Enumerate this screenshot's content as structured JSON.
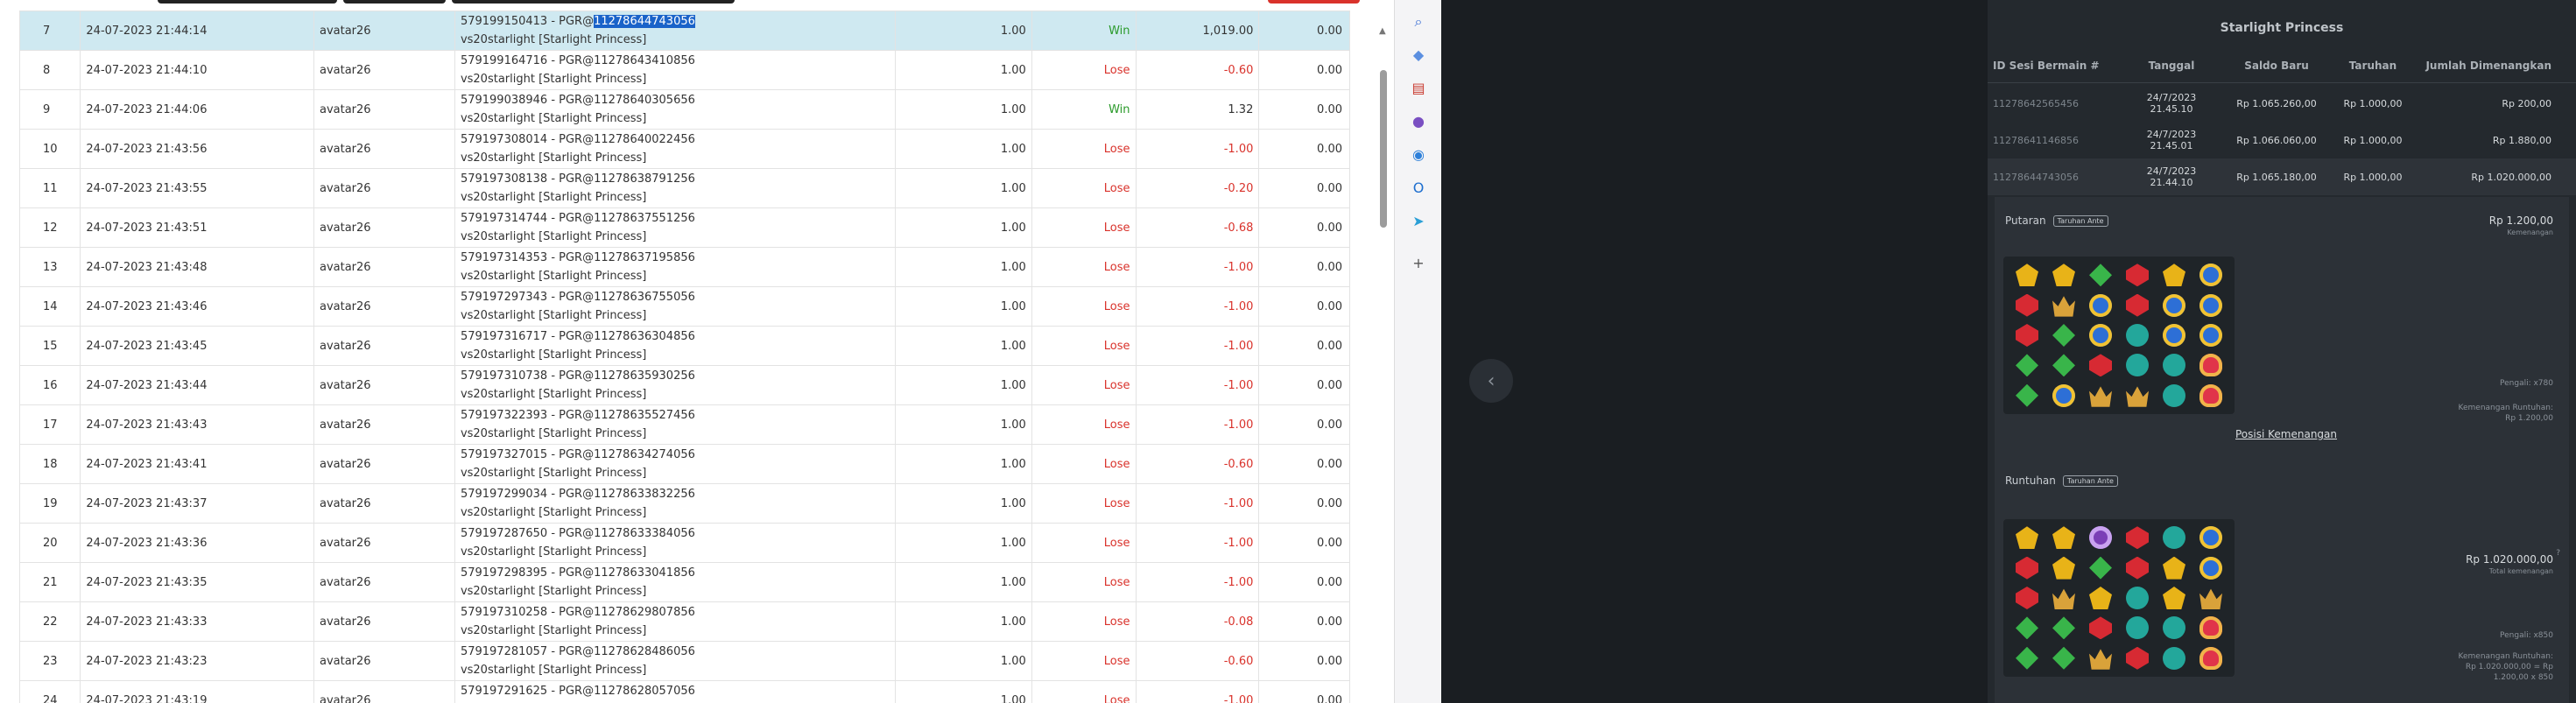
{
  "table": {
    "rows": [
      {
        "no": "7",
        "date": "24-07-2023 21:44:14",
        "user": "avatar26",
        "desc_prefix": "579199150413 - PGR@",
        "desc_selected": "11278644743056",
        "desc_line2": "vs20starlight [Starlight Princess]",
        "bet": "1.00",
        "result": "Win",
        "win": "1,019.00",
        "balance": "0.00"
      },
      {
        "no": "8",
        "date": "24-07-2023 21:44:10",
        "user": "avatar26",
        "desc_prefix": "579199164716 - PGR@11278643410856",
        "desc_selected": "",
        "desc_line2": "vs20starlight [Starlight Princess]",
        "bet": "1.00",
        "result": "Lose",
        "win": "-0.60",
        "balance": "0.00"
      },
      {
        "no": "9",
        "date": "24-07-2023 21:44:06",
        "user": "avatar26",
        "desc_prefix": "579199038946 - PGR@11278640305656",
        "desc_selected": "",
        "desc_line2": "vs20starlight [Starlight Princess]",
        "bet": "1.00",
        "result": "Win",
        "win": "1.32",
        "balance": "0.00"
      },
      {
        "no": "10",
        "date": "24-07-2023 21:43:56",
        "user": "avatar26",
        "desc_prefix": "579197308014 - PGR@11278640022456",
        "desc_selected": "",
        "desc_line2": "vs20starlight [Starlight Princess]",
        "bet": "1.00",
        "result": "Lose",
        "win": "-1.00",
        "balance": "0.00"
      },
      {
        "no": "11",
        "date": "24-07-2023 21:43:55",
        "user": "avatar26",
        "desc_prefix": "579197308138 - PGR@11278638791256",
        "desc_selected": "",
        "desc_line2": "vs20starlight [Starlight Princess]",
        "bet": "1.00",
        "result": "Lose",
        "win": "-0.20",
        "balance": "0.00"
      },
      {
        "no": "12",
        "date": "24-07-2023 21:43:51",
        "user": "avatar26",
        "desc_prefix": "579197314744 - PGR@11278637551256",
        "desc_selected": "",
        "desc_line2": "vs20starlight [Starlight Princess]",
        "bet": "1.00",
        "result": "Lose",
        "win": "-0.68",
        "balance": "0.00"
      },
      {
        "no": "13",
        "date": "24-07-2023 21:43:48",
        "user": "avatar26",
        "desc_prefix": "579197314353 - PGR@11278637195856",
        "desc_selected": "",
        "desc_line2": "vs20starlight [Starlight Princess]",
        "bet": "1.00",
        "result": "Lose",
        "win": "-1.00",
        "balance": "0.00"
      },
      {
        "no": "14",
        "date": "24-07-2023 21:43:46",
        "user": "avatar26",
        "desc_prefix": "579197297343 - PGR@11278636755056",
        "desc_selected": "",
        "desc_line2": "vs20starlight [Starlight Princess]",
        "bet": "1.00",
        "result": "Lose",
        "win": "-1.00",
        "balance": "0.00"
      },
      {
        "no": "15",
        "date": "24-07-2023 21:43:45",
        "user": "avatar26",
        "desc_prefix": "579197316717 - PGR@11278636304856",
        "desc_selected": "",
        "desc_line2": "vs20starlight [Starlight Princess]",
        "bet": "1.00",
        "result": "Lose",
        "win": "-1.00",
        "balance": "0.00"
      },
      {
        "no": "16",
        "date": "24-07-2023 21:43:44",
        "user": "avatar26",
        "desc_prefix": "579197310738 - PGR@11278635930256",
        "desc_selected": "",
        "desc_line2": "vs20starlight [Starlight Princess]",
        "bet": "1.00",
        "result": "Lose",
        "win": "-1.00",
        "balance": "0.00"
      },
      {
        "no": "17",
        "date": "24-07-2023 21:43:43",
        "user": "avatar26",
        "desc_prefix": "579197322393 - PGR@11278635527456",
        "desc_selected": "",
        "desc_line2": "vs20starlight [Starlight Princess]",
        "bet": "1.00",
        "result": "Lose",
        "win": "-1.00",
        "balance": "0.00"
      },
      {
        "no": "18",
        "date": "24-07-2023 21:43:41",
        "user": "avatar26",
        "desc_prefix": "579197327015 - PGR@11278634274056",
        "desc_selected": "",
        "desc_line2": "vs20starlight [Starlight Princess]",
        "bet": "1.00",
        "result": "Lose",
        "win": "-0.60",
        "balance": "0.00"
      },
      {
        "no": "19",
        "date": "24-07-2023 21:43:37",
        "user": "avatar26",
        "desc_prefix": "579197299034 - PGR@11278633832256",
        "desc_selected": "",
        "desc_line2": "vs20starlight [Starlight Princess]",
        "bet": "1.00",
        "result": "Lose",
        "win": "-1.00",
        "balance": "0.00"
      },
      {
        "no": "20",
        "date": "24-07-2023 21:43:36",
        "user": "avatar26",
        "desc_prefix": "579197287650 - PGR@11278633384056",
        "desc_selected": "",
        "desc_line2": "vs20starlight [Starlight Princess]",
        "bet": "1.00",
        "result": "Lose",
        "win": "-1.00",
        "balance": "0.00"
      },
      {
        "no": "21",
        "date": "24-07-2023 21:43:35",
        "user": "avatar26",
        "desc_prefix": "579197298395 - PGR@11278633041856",
        "desc_selected": "",
        "desc_line2": "vs20starlight [Starlight Princess]",
        "bet": "1.00",
        "result": "Lose",
        "win": "-1.00",
        "balance": "0.00"
      },
      {
        "no": "22",
        "date": "24-07-2023 21:43:33",
        "user": "avatar26",
        "desc_prefix": "579197310258 - PGR@11278629807856",
        "desc_selected": "",
        "desc_line2": "vs20starlight [Starlight Princess]",
        "bet": "1.00",
        "result": "Lose",
        "win": "-0.08",
        "balance": "0.00"
      },
      {
        "no": "23",
        "date": "24-07-2023 21:43:23",
        "user": "avatar26",
        "desc_prefix": "579197281057 - PGR@11278628486056",
        "desc_selected": "",
        "desc_line2": "vs20starlight [Starlight Princess]",
        "bet": "1.00",
        "result": "Lose",
        "win": "-0.60",
        "balance": "0.00"
      },
      {
        "no": "24",
        "date": "24-07-2023 21:43:19",
        "user": "avatar26",
        "desc_prefix": "579197291625 - PGR@11278628057056",
        "desc_selected": "",
        "desc_line2": "vs20starlight [Starlight Princess]",
        "bet": "1.00",
        "result": "Lose",
        "win": "-1.00",
        "balance": "0.00"
      }
    ]
  },
  "sidebar": {
    "icons": [
      {
        "name": "search-icon",
        "glyph": "⌕",
        "color": "#3b6fd4"
      },
      {
        "name": "tag-icon",
        "glyph": "◆",
        "color": "#5b8fe0"
      },
      {
        "name": "toolbox-icon",
        "glyph": "▤",
        "color": "#c9392f"
      },
      {
        "name": "people-icon",
        "glyph": "●",
        "color": "#7a4fc2"
      },
      {
        "name": "copilot-icon",
        "glyph": "◉",
        "color": "#2d7fd9"
      },
      {
        "name": "outlook-icon",
        "glyph": "O",
        "color": "#1f6fcf"
      },
      {
        "name": "paper-plane-icon",
        "glyph": "➤",
        "color": "#2a9fd6"
      },
      {
        "name": "plus-icon",
        "glyph": "+",
        "color": "#555555"
      }
    ]
  },
  "game": {
    "back_glyph": "‹",
    "title": "Starlight Princess",
    "headers": {
      "id": "ID Sesi Bermain #",
      "date": "Tanggal",
      "saldo": "Saldo Baru",
      "bet": "Taruhan",
      "win": "Jumlah Dimenangkan"
    },
    "rows": [
      {
        "id": "11278642565456",
        "date": "24/7/2023 21.45.10",
        "saldo": "Rp 1.065.260,00",
        "bet": "Rp 1.000,00",
        "win": "Rp 200,00"
      },
      {
        "id": "11278641146856",
        "date": "24/7/2023 21.45.01",
        "saldo": "Rp 1.066.060,00",
        "bet": "Rp 1.000,00",
        "win": "Rp 1.880,00"
      },
      {
        "id": "11278644743056",
        "date": "24/7/2023 21.44.10",
        "saldo": "Rp 1.065.180,00",
        "bet": "Rp 1.000,00",
        "win": "Rp 1.020.000,00"
      }
    ],
    "spin": {
      "label": "Putaran",
      "badge": "Taruhan Ante",
      "amount": "Rp 1.200,00",
      "amount_sub": "Kemenangan",
      "note1": "Pengali: x780",
      "note2": "Kemenangan Runtuhan:",
      "note3": "Rp 1.200,00",
      "link": "Posisi Kemenangan"
    },
    "tumble": {
      "label": "Runtuhan",
      "badge": "Taruhan Ante",
      "amount": "Rp 1.020.000,00",
      "amount_sub": "Total kemenangan",
      "note1": "Pengali: x850",
      "note2": "Kemenangan Runtuhan:",
      "note3": "Rp 1.020.000,00 = Rp",
      "note4": "1.200,00 x 850",
      "info_glyph": "?"
    },
    "grid1": [
      "yellow",
      "yellow",
      "green",
      "red",
      "yellow",
      "blue",
      "red",
      "crown",
      "blue",
      "red",
      "blue",
      "blue",
      "red",
      "green",
      "blue",
      "teal",
      "blue",
      "blue",
      "green",
      "green",
      "red",
      "teal",
      "teal",
      "heart",
      "green",
      "blue",
      "crown",
      "crown",
      "teal",
      "heart"
    ],
    "grid2": [
      "yellow",
      "yellow",
      "purple",
      "red",
      "teal",
      "blue",
      "red",
      "yellow",
      "green",
      "red",
      "yellow",
      "blue",
      "red",
      "crown",
      "yellow",
      "teal",
      "yellow",
      "crown",
      "green",
      "green",
      "red",
      "teal",
      "teal",
      "heart",
      "green",
      "green",
      "crown",
      "red",
      "teal",
      "heart"
    ]
  }
}
